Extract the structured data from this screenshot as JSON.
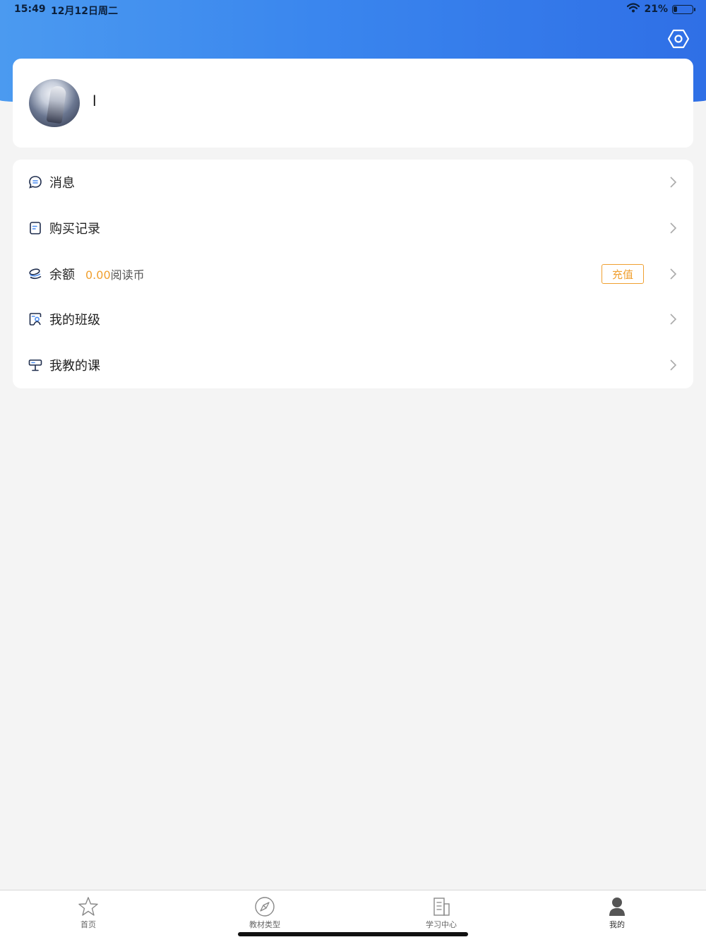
{
  "status_bar": {
    "time": "15:49",
    "date": "12月12日周二",
    "battery": "21%",
    "battery_level": 0.21
  },
  "header": {
    "settings_icon": "settings-hexagon-icon"
  },
  "profile": {
    "username": "l",
    "avatar_icon": "avatar-image"
  },
  "menu": {
    "items": [
      {
        "label": "消息",
        "icon": "message-bubble-icon"
      },
      {
        "label": "购买记录",
        "icon": "receipt-icon"
      },
      {
        "label": "余额",
        "icon": "coins-icon",
        "value": "0.00",
        "unit": "阅读币",
        "action": "充值"
      },
      {
        "label": "我的班级",
        "icon": "class-icon"
      },
      {
        "label": "我教的课",
        "icon": "lectern-icon"
      }
    ]
  },
  "tab_bar": {
    "tabs": [
      {
        "label": "首页",
        "icon": "star-icon"
      },
      {
        "label": "教材类型",
        "icon": "compass-icon"
      },
      {
        "label": "学习中心",
        "icon": "building-icon"
      },
      {
        "label": "我的",
        "icon": "person-icon",
        "active": true
      }
    ]
  },
  "colors": {
    "header_blue": "#3a86ee",
    "accent_orange": "#f0a030",
    "background": "#f4f4f4"
  }
}
